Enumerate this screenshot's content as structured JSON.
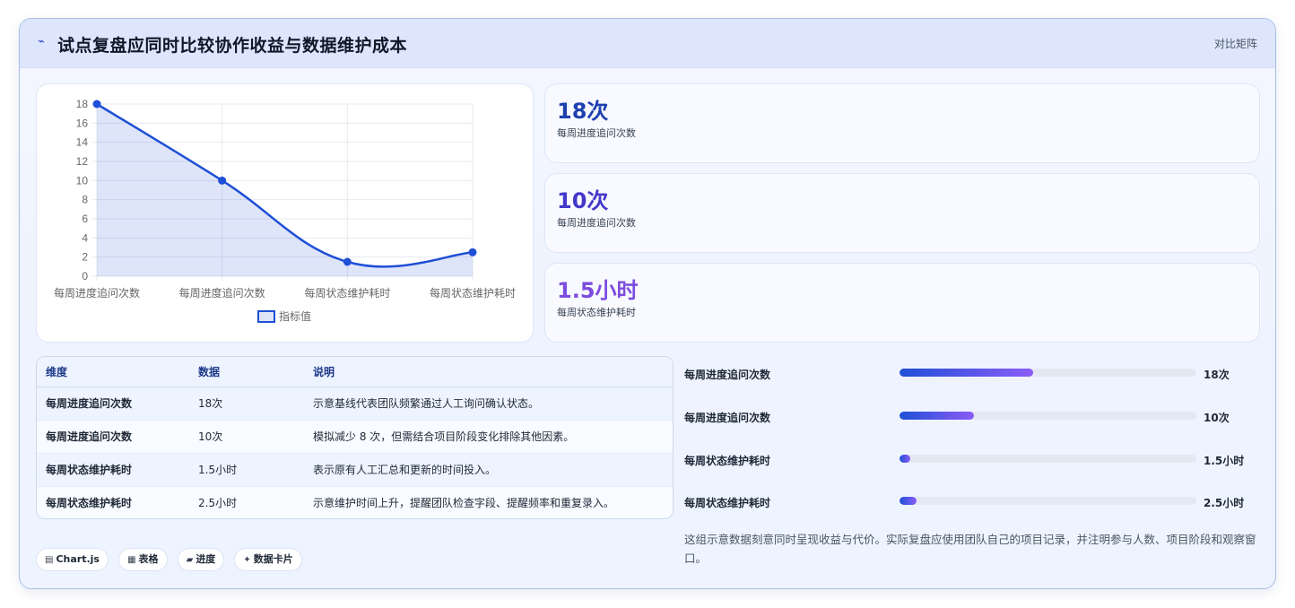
{
  "header": {
    "icon": "sparkle-icon",
    "title": "试点复盘应同时比较协作收益与数据维护成本",
    "right_label": "对比矩阵"
  },
  "chart_data": {
    "type": "line",
    "categories": [
      "每周进度追问次数",
      "每周进度追问次数",
      "每周状态维护耗时",
      "每周状态维护耗时"
    ],
    "series": [
      {
        "name": "指标值",
        "values": [
          18,
          10,
          1.5,
          2.5
        ]
      }
    ],
    "yticks": [
      "0",
      "2",
      "4",
      "6",
      "8",
      "10",
      "12",
      "14",
      "16",
      "18"
    ],
    "ylim": [
      0,
      18
    ],
    "legend_position": "bottom",
    "grid": true,
    "fill": true,
    "color": "#1f4fd6"
  },
  "stats": [
    {
      "value": "18次",
      "label": "每周进度追问次数",
      "color": "#1e40af"
    },
    {
      "value": "10次",
      "label": "每周进度追问次数",
      "color": "#4338ca"
    },
    {
      "value": "1.5小时",
      "label": "每周状态维护耗时",
      "color": "#7c4ddf"
    }
  ],
  "table": {
    "headers": [
      "维度",
      "数据",
      "说明"
    ],
    "rows": [
      [
        "每周进度追问次数",
        "18次",
        "示意基线代表团队频繁通过人工询问确认状态。"
      ],
      [
        "每周进度追问次数",
        "10次",
        "模拟减少 8 次，但需结合项目阶段变化排除其他因素。"
      ],
      [
        "每周状态维护耗时",
        "1.5小时",
        "表示原有人工汇总和更新的时间投入。"
      ],
      [
        "每周状态维护耗时",
        "2.5小时",
        "示意维护时间上升，提醒团队检查字段、提醒频率和重复录入。"
      ]
    ]
  },
  "bars": [
    {
      "label": "每周进度追问次数",
      "value": "18次",
      "fraction": 0.45
    },
    {
      "label": "每周进度追问次数",
      "value": "10次",
      "fraction": 0.25
    },
    {
      "label": "每周状态维护耗时",
      "value": "1.5小时",
      "fraction": 0.037
    },
    {
      "label": "每周状态维护耗时",
      "value": "2.5小时",
      "fraction": 0.058
    }
  ],
  "note": "这组示意数据刻意同时呈现收益与代价。实际复盘应使用团队自己的项目记录，并注明参与人数、项目阶段和观察窗口。",
  "tags": [
    {
      "icon": "chart-icon",
      "glyph": "▤",
      "label": "Chart.js"
    },
    {
      "icon": "table-icon",
      "glyph": "▦",
      "label": "表格"
    },
    {
      "icon": "progress-icon",
      "glyph": "▰",
      "label": "进度"
    },
    {
      "icon": "card-icon",
      "glyph": "✦",
      "label": "数据卡片"
    }
  ]
}
